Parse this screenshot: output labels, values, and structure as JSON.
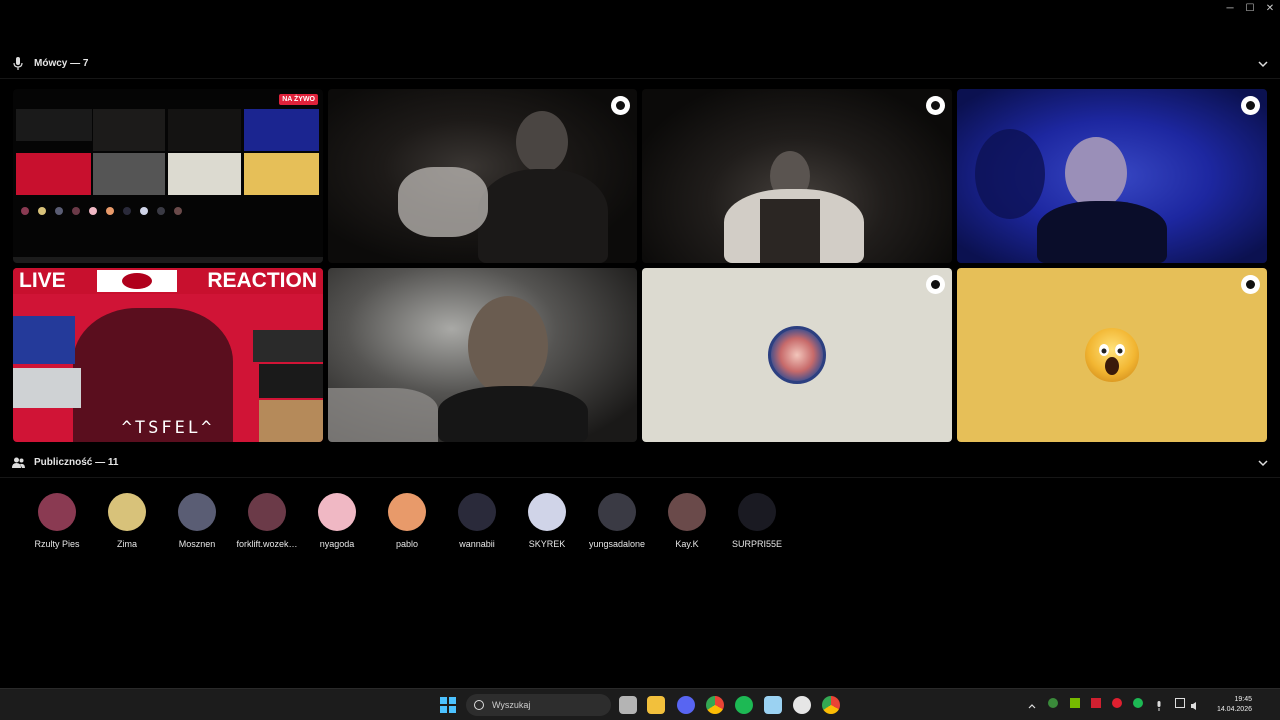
{
  "window": {
    "minimize": "─",
    "maximize": "☐",
    "close": "✕"
  },
  "speakers": {
    "title": "Mówcy — 7",
    "icon": "microphone-icon",
    "live_badge": "NA ŻYWO"
  },
  "stream_overlay": {
    "left": "LIVE",
    "right": "REACTION",
    "footer": "^TSFEL^"
  },
  "audience": {
    "title": "Publiczność — 11",
    "icon": "people-icon",
    "members": [
      {
        "name": "Rzulty Pies",
        "color": "#8a3a52"
      },
      {
        "name": "Zima",
        "color": "#d8c27a"
      },
      {
        "name": "Mosznen",
        "color": "#5a5d74"
      },
      {
        "name": "forklift.wozek…",
        "color": "#6b3a48"
      },
      {
        "name": "nyagoda",
        "color": "#f0b8c4"
      },
      {
        "name": "pablo",
        "color": "#e89a6a"
      },
      {
        "name": "wannabii",
        "color": "#2a2a3a"
      },
      {
        "name": "SKYREK",
        "color": "#d0d4e8"
      },
      {
        "name": "yungsadalone",
        "color": "#3a3a44"
      },
      {
        "name": "Kay.K",
        "color": "#6a4a4a"
      },
      {
        "name": "SURPRI55E",
        "color": "#1a1a22"
      }
    ]
  },
  "taskbar": {
    "search_placeholder": "Wyszukaj",
    "time": "19:45",
    "date": "14.04.2026"
  },
  "colors": {
    "accent": "#4cc2ff",
    "live": "#e0223b",
    "tile_beige": "#dcdad0",
    "tile_yellow": "#e6bf58"
  }
}
